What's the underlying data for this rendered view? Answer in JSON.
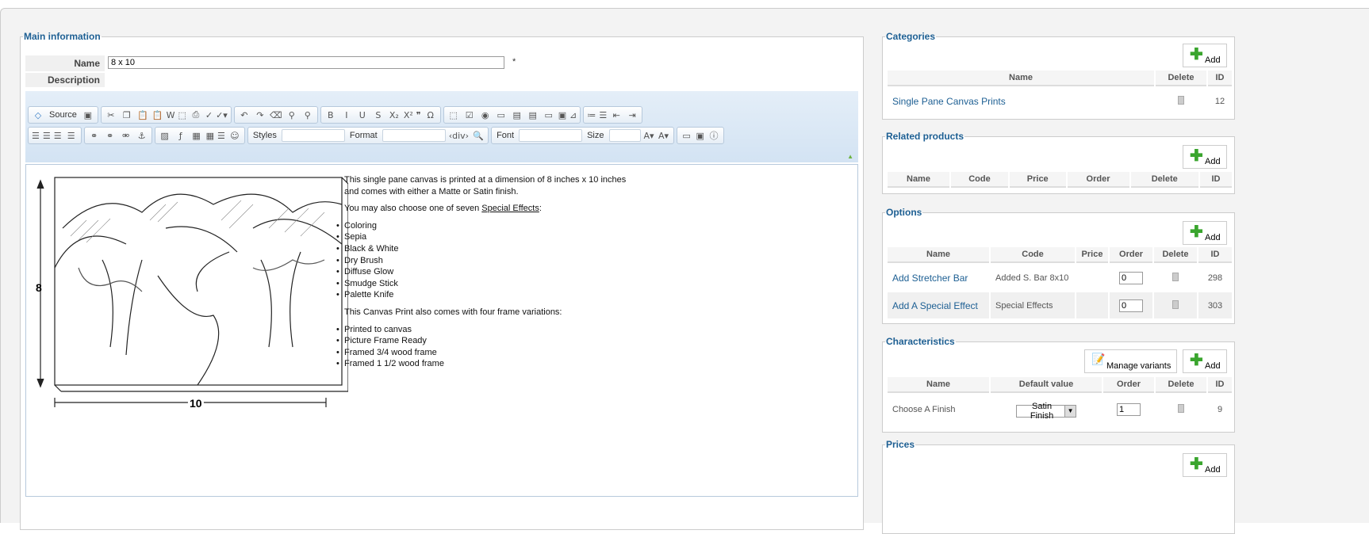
{
  "main": {
    "legend": "Main information",
    "name_label": "Name",
    "name_value": "8 x 10",
    "required": "*",
    "description_label": "Description"
  },
  "toolbar": {
    "row1": [
      [
        "source-icon",
        "save-icon"
      ],
      [
        "cut-icon",
        "copy-icon",
        "paste-icon",
        "paste-text-icon",
        "paste-word-icon",
        "select-all-icon",
        "print-icon",
        "spellcheck-icon",
        "spellcheck-dropdown-icon"
      ],
      [
        "undo-icon",
        "redo-icon",
        "eraser-icon",
        "find-icon",
        "replace-icon"
      ],
      [
        "bold-icon",
        "italic-icon",
        "underline-icon",
        "strike-icon",
        "subscript-icon",
        "superscript-icon",
        "blockquote-icon",
        "omega-icon"
      ],
      [
        "form-icon",
        "checkbox-icon",
        "radio-icon",
        "textfield-icon",
        "textarea-icon",
        "select-icon",
        "button-icon",
        "image-button-icon",
        "hidden-field-icon"
      ],
      [
        "numbered-list-icon",
        "bullet-list-icon",
        "outdent-icon",
        "indent-icon"
      ]
    ],
    "row2": [
      [
        "align-left-icon",
        "align-center-icon",
        "align-right-icon",
        "justify-icon"
      ],
      [
        "link-icon",
        "add-link-icon",
        "unlink-icon",
        "anchor-icon"
      ],
      [
        "image-icon",
        "flash-icon",
        "table-icon",
        "table-grid-icon",
        "horizontal-rule-icon",
        "smiley-icon"
      ],
      [
        "styles",
        "format",
        "div-icon",
        "zoom-icon"
      ],
      [
        "font",
        "size",
        "text-color-icon",
        "bg-color-icon"
      ],
      [
        "maximize-icon",
        "show-blocks-icon",
        "about-icon"
      ]
    ],
    "source_label": "Source",
    "styles_label": "Styles",
    "format_label": "Format",
    "font_label": "Font",
    "size_label": "Size"
  },
  "content": {
    "image_labels": {
      "height": "8",
      "width": "10"
    },
    "p1": "This single pane canvas is printed at a dimension of 8 inches x 10 inches",
    "p1b": "and comes with either a Matte or Satin finish.",
    "p2_pre": "You may also choose one of seven ",
    "p2_link": "Special Effects",
    "p2_post": ":",
    "effects": [
      "Coloring",
      "Sepia",
      "Black & White",
      "Dry Brush",
      "Diffuse Glow",
      "Smudge Stick",
      "Palette Knife"
    ],
    "p3": "This Canvas Print also comes with four frame variations:",
    "frames": [
      "Printed to canvas",
      "Picture Frame Ready",
      "Framed 3/4 wood frame",
      "Framed 1 1/2 wood frame"
    ]
  },
  "add_label": "Add",
  "categories": {
    "legend": "Categories",
    "headers": [
      "Name",
      "Delete",
      "ID"
    ],
    "rows": [
      {
        "name": "Single Pane Canvas Prints",
        "id": "12"
      }
    ]
  },
  "related": {
    "legend": "Related products",
    "headers": [
      "Name",
      "Code",
      "Price",
      "Order",
      "Delete",
      "ID"
    ]
  },
  "options": {
    "legend": "Options",
    "headers": [
      "Name",
      "Code",
      "Price",
      "Order",
      "Delete",
      "ID"
    ],
    "rows": [
      {
        "name": "Add Stretcher Bar",
        "code": "Added S. Bar 8x10",
        "price": "",
        "order": "0",
        "id": "298"
      },
      {
        "name": "Add A Special Effect",
        "code": "Special Effects",
        "price": "",
        "order": "0",
        "id": "303"
      }
    ]
  },
  "characteristics": {
    "legend": "Characteristics",
    "manage_label": "Manage variants",
    "headers": [
      "Name",
      "Default value",
      "Order",
      "Delete",
      "ID"
    ],
    "rows": [
      {
        "name": "Choose A Finish",
        "default": "Satin Finish",
        "order": "1",
        "id": "9"
      }
    ]
  },
  "prices": {
    "legend": "Prices"
  }
}
